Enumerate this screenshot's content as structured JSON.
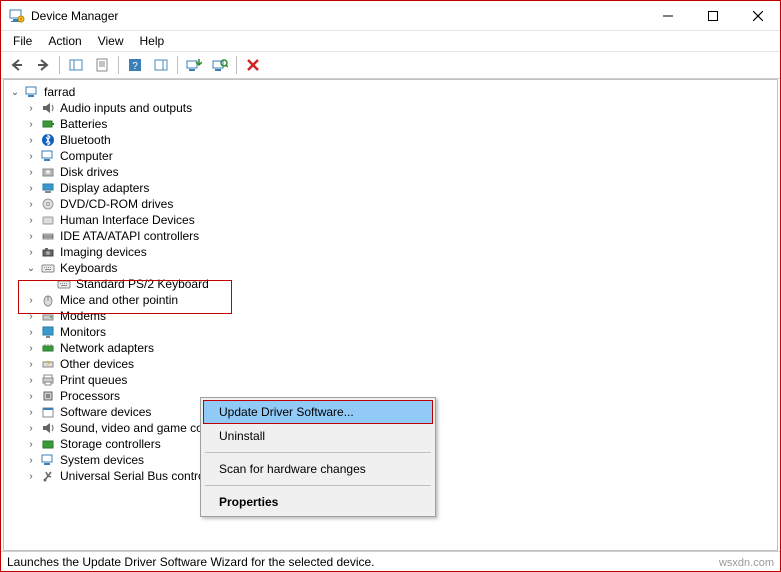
{
  "window": {
    "title": "Device Manager"
  },
  "menu": {
    "file": "File",
    "action": "Action",
    "view": "View",
    "help": "Help"
  },
  "tree": {
    "root": "farrad",
    "items": [
      "Audio inputs and outputs",
      "Batteries",
      "Bluetooth",
      "Computer",
      "Disk drives",
      "Display adapters",
      "DVD/CD-ROM drives",
      "Human Interface Devices",
      "IDE ATA/ATAPI controllers",
      "Imaging devices",
      "Keyboards",
      "Standard PS/2 Keyboard",
      "Mice and other pointin",
      "Modems",
      "Monitors",
      "Network adapters",
      "Other devices",
      "Print queues",
      "Processors",
      "Software devices",
      "Sound, video and game controllers",
      "Storage controllers",
      "System devices",
      "Universal Serial Bus controllers"
    ]
  },
  "context_menu": {
    "update": "Update Driver Software...",
    "uninstall": "Uninstall",
    "scan": "Scan for hardware changes",
    "properties": "Properties"
  },
  "status": "Launches the Update Driver Software Wizard for the selected device.",
  "attribution": "wsxdn.com"
}
